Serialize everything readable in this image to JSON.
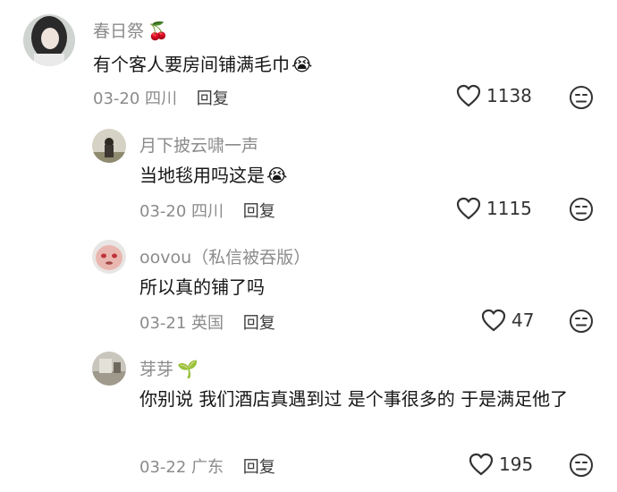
{
  "comments": [
    {
      "username": "春日祭",
      "username_emoji": "🍒",
      "text": "有个客人要房间铺满毛巾",
      "text_emoji": "😭",
      "date": "03-20",
      "location": "四川",
      "reply_label": "回复",
      "likes": "1138",
      "avatar_icon": "avatar-girl-photo"
    },
    {
      "username": "月下披云啸一声",
      "text": "当地毯用吗这是",
      "text_emoji": "😭",
      "date": "03-20",
      "location": "四川",
      "reply_label": "回复",
      "likes": "1115",
      "avatar_icon": "avatar-figure-photo"
    },
    {
      "username": "oovou（私信被吞版）",
      "text": "所以真的铺了吗",
      "date": "03-21",
      "location": "英国",
      "reply_label": "回复",
      "likes": "47",
      "avatar_icon": "avatar-face-photo"
    },
    {
      "username": "芽芽",
      "username_emoji": "🌱",
      "text": "你别说 我们酒店真遇到过 是个事很多的 于是满足他了",
      "date": "03-22",
      "location": "广东",
      "reply_label": "回复",
      "likes": "195",
      "avatar_icon": "avatar-room-photo"
    }
  ],
  "icons": {
    "like": "heart-outline-icon",
    "dislike": "meh-face-icon"
  },
  "colors": {
    "meta_gray": "#8b8b8b",
    "text": "#161616",
    "icon_stroke": "#333333"
  }
}
